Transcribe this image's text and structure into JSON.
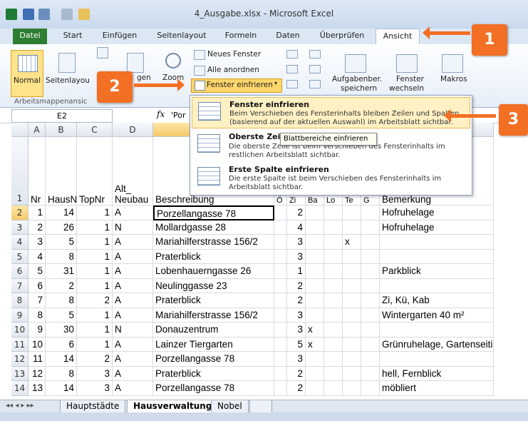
{
  "window": {
    "title": "4_Ausgabe.xlsx - Microsoft Excel"
  },
  "ribbon_tabs": [
    "Datei",
    "Start",
    "Einfügen",
    "Seitenlayout",
    "Formeln",
    "Daten",
    "Überprüfen",
    "Ansicht"
  ],
  "ribbon": {
    "normal_label": "Normal",
    "seitenlayout_label": "Seitenlayou",
    "umbrueche_label": "gen",
    "zoom_label": "Zoom",
    "neues_fenster": "Neues Fenster",
    "alle_anordnen": "Alle anordnen",
    "fenster_einfrieren": "Fenster einfrieren",
    "aufgabenber_line1": "Aufgabenber.",
    "aufgabenber_line2": "speichern",
    "fenster_wechseln_line1": "Fenster",
    "fenster_wechseln_line2": "wechseln",
    "makros_label": "Makros",
    "group_arbeitsmappen": "Arbeitsmappenansic"
  },
  "formula_bar": {
    "name_box": "E2",
    "fx": "fx",
    "value": "'Por"
  },
  "columns": [
    "A",
    "B",
    "C",
    "D",
    "E",
    "F",
    "G",
    "H",
    "I",
    "J",
    "K",
    "L"
  ],
  "header_row": {
    "row": "1",
    "A": "Nr",
    "B": "HausNr",
    "C": "TopNr",
    "D_top": "Alt_",
    "D": "Neubau",
    "E": "Beschreibung",
    "F": "Ö",
    "G": "Zi",
    "H": "Ba",
    "I": "Lo",
    "J": "Te",
    "K": "G",
    "L": "Bemerkung"
  },
  "rows": [
    {
      "r": "2",
      "A": "1",
      "B": "14",
      "C": "1",
      "D": "A",
      "E": "Porzellangasse 78",
      "G": "2",
      "H": "",
      "I": "",
      "J": "",
      "L": ""
    },
    {
      "r": "3",
      "A": "2",
      "B": "26",
      "C": "1",
      "D": "N",
      "E": "Mollardgasse 28",
      "G": "4",
      "H": "",
      "I": "",
      "J": "",
      "L": ""
    },
    {
      "r": "4",
      "A": "3",
      "B": "5",
      "C": "1",
      "D": "A",
      "E": "Mariahilferstrasse 156/2",
      "G": "3",
      "H": "",
      "I": "",
      "J": "x",
      "L": ""
    },
    {
      "r": "5",
      "A": "4",
      "B": "8",
      "C": "1",
      "D": "A",
      "E": "Praterblick",
      "G": "3",
      "H": "",
      "I": "",
      "J": "",
      "L": ""
    },
    {
      "r": "6",
      "A": "5",
      "B": "31",
      "C": "1",
      "D": "A",
      "E": "Lobenhauerngasse 26",
      "G": "1",
      "H": "",
      "I": "",
      "J": "",
      "L": "Parkblick"
    },
    {
      "r": "7",
      "A": "6",
      "B": "2",
      "C": "1",
      "D": "A",
      "E": "Neulinggasse 23",
      "G": "2",
      "H": "",
      "I": "",
      "J": "",
      "L": ""
    },
    {
      "r": "8",
      "A": "7",
      "B": "8",
      "C": "2",
      "D": "A",
      "E": "Praterblick",
      "G": "2",
      "H": "",
      "I": "",
      "J": "",
      "L": "Zi, Kü, Kab"
    },
    {
      "r": "9",
      "A": "8",
      "B": "5",
      "C": "1",
      "D": "A",
      "E": "Mariahilferstrasse 156/2",
      "G": "3",
      "H": "",
      "I": "",
      "J": "",
      "L": "Wintergarten 40 m²"
    },
    {
      "r": "10",
      "A": "9",
      "B": "30",
      "C": "1",
      "D": "N",
      "E": "Donauzentrum",
      "G": "3",
      "H": "x",
      "I": "",
      "J": "",
      "L": ""
    },
    {
      "r": "11",
      "A": "10",
      "B": "6",
      "C": "1",
      "D": "A",
      "E": "Lainzer Tiergarten",
      "G": "5",
      "H": "x",
      "I": "",
      "J": "",
      "L": "Grünruhelage, Gartenseitig"
    },
    {
      "r": "12",
      "A": "11",
      "B": "14",
      "C": "2",
      "D": "A",
      "E": "Porzellangasse 78",
      "G": "3",
      "H": "",
      "I": "",
      "J": "",
      "L": ""
    },
    {
      "r": "13",
      "A": "12",
      "B": "8",
      "C": "3",
      "D": "A",
      "E": "Praterblick",
      "G": "2",
      "H": "",
      "I": "",
      "J": "",
      "L": "hell, Fernblick"
    },
    {
      "r": "14",
      "A": "13",
      "B": "14",
      "C": "3",
      "D": "A",
      "E": "Porzellangasse 78",
      "G": "2",
      "H": "",
      "I": "",
      "J": "",
      "L": "möbliert"
    }
  ],
  "row2_L": "Hofruhelage",
  "row3_L": "Hofruhelage",
  "sheet_tabs": [
    "Hauptstädte",
    "Hausverwaltung",
    "Nobel"
  ],
  "dropdown": {
    "item1_title": "Fenster einfrieren",
    "item1_desc": "Beim Verschieben des Fensterinhalts bleiben Zeilen und Spalten (basierend auf der aktuellen Auswahl) im Arbeitsblatt sichtbar.",
    "item2_title": "Oberste Zeile",
    "item2_desc": "Die oberste Zeile ist beim Verschieben des Fensterinhalts im restlichen Arbeitsblatt sichtbar.",
    "item3_title": "Erste Spalte einfrieren",
    "item3_desc": "Die erste Spalte ist beim Verschieben des Fensterinhalts im Arbeitsblatt sichtbar."
  },
  "tooltip": "Blattbereiche einfrieren",
  "callouts": [
    "1",
    "2",
    "3"
  ],
  "colors": {
    "accent": "#f36f24",
    "datei_tab": "#2e7d32"
  }
}
